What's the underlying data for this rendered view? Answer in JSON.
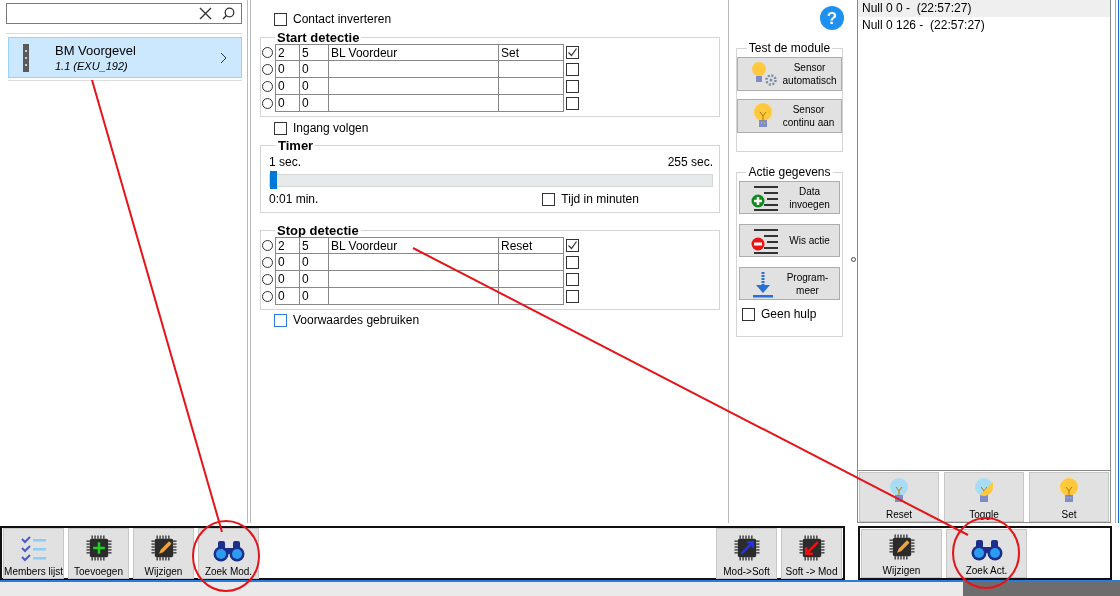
{
  "modules": [
    {
      "name": "BM Voorgevel",
      "address": "1.1 (EXU_192)",
      "selected": true
    }
  ],
  "contact_invert": {
    "label": "Contact inverteren",
    "checked": false
  },
  "start_detection": {
    "title": "Start detectie",
    "rows": [
      {
        "selected": false,
        "col_1": "2",
        "col_2": "5",
        "col_3": "BL Voordeur",
        "col_4": "Set",
        "checked": true
      },
      {
        "selected": false,
        "col_1": "0",
        "col_2": "0",
        "col_3": "",
        "col_4": "",
        "checked": false
      },
      {
        "selected": false,
        "col_1": "0",
        "col_2": "0",
        "col_3": "",
        "col_4": "",
        "checked": false
      },
      {
        "selected": false,
        "col_1": "0",
        "col_2": "0",
        "col_3": "",
        "col_4": "",
        "checked": false
      }
    ]
  },
  "follow_input": {
    "label": "Ingang volgen",
    "checked": false
  },
  "timer": {
    "title": "Timer",
    "min_label": "1 sec.",
    "max_label": "255 sec.",
    "level": 0,
    "reading": "0:01 min.",
    "minutes": {
      "label": "Tijd in minuten",
      "checked": false
    }
  },
  "stop_detection": {
    "title": "Stop detectie",
    "rows": [
      {
        "selected": false,
        "col_1": "2",
        "col_2": "5",
        "col_3": "BL Voordeur",
        "col_4": "Reset",
        "checked": true
      },
      {
        "selected": false,
        "col_1": "0",
        "col_2": "0",
        "col_3": "",
        "col_4": "",
        "checked": false
      },
      {
        "selected": false,
        "col_1": "0",
        "col_2": "0",
        "col_3": "",
        "col_4": "",
        "checked": false
      },
      {
        "selected": false,
        "col_1": "0",
        "col_2": "0",
        "col_3": "",
        "col_4": "",
        "checked": false
      }
    ]
  },
  "use_conditions": {
    "label": "Voorwaardes gebruiken",
    "checked": false
  },
  "test_module": {
    "title": "Test de module",
    "buttons": [
      {
        "label": "Sensor automatisch",
        "kind": "bulb-gear"
      },
      {
        "label": "Sensor continu aan",
        "kind": "bulb-on"
      }
    ]
  },
  "action_data": {
    "title": "Actie gegevens",
    "buttons": [
      {
        "label": "Data invoegen",
        "kind": "list-add"
      },
      {
        "label": "Wis actie",
        "kind": "list-remove"
      },
      {
        "label": "Program-meer",
        "kind": "download"
      }
    ],
    "no_help": {
      "label": "Geen hulp",
      "checked": false
    }
  },
  "help_icon": "?",
  "log": [
    {
      "text": "Null 0 0 -  (22:57:27)",
      "selected": true
    },
    {
      "text": "Null 0 126 -  (22:57:27)",
      "selected": false
    }
  ],
  "output_buttons": [
    {
      "label": "Reset",
      "kind": "bulb-off"
    },
    {
      "label": "Toggle",
      "kind": "bulb-half"
    },
    {
      "label": "Set",
      "kind": "bulb-on"
    }
  ],
  "module_toolbar": [
    {
      "label": "Members lijst",
      "kind": "checklist"
    },
    {
      "label": "Toevoegen",
      "kind": "chip-add"
    },
    {
      "label": "Wijzigen",
      "kind": "chip-edit"
    },
    {
      "label": "Zoek Mod.",
      "kind": "binoculars"
    }
  ],
  "transfer_toolbar": [
    {
      "label": "Mod->Soft",
      "kind": "chip-up"
    },
    {
      "label": "Soft -> Mod",
      "kind": "chip-down"
    }
  ],
  "action_toolbar": [
    {
      "label": "Wijzigen",
      "kind": "chip-edit"
    },
    {
      "label": "Zoek Act.",
      "kind": "binoculars"
    }
  ]
}
